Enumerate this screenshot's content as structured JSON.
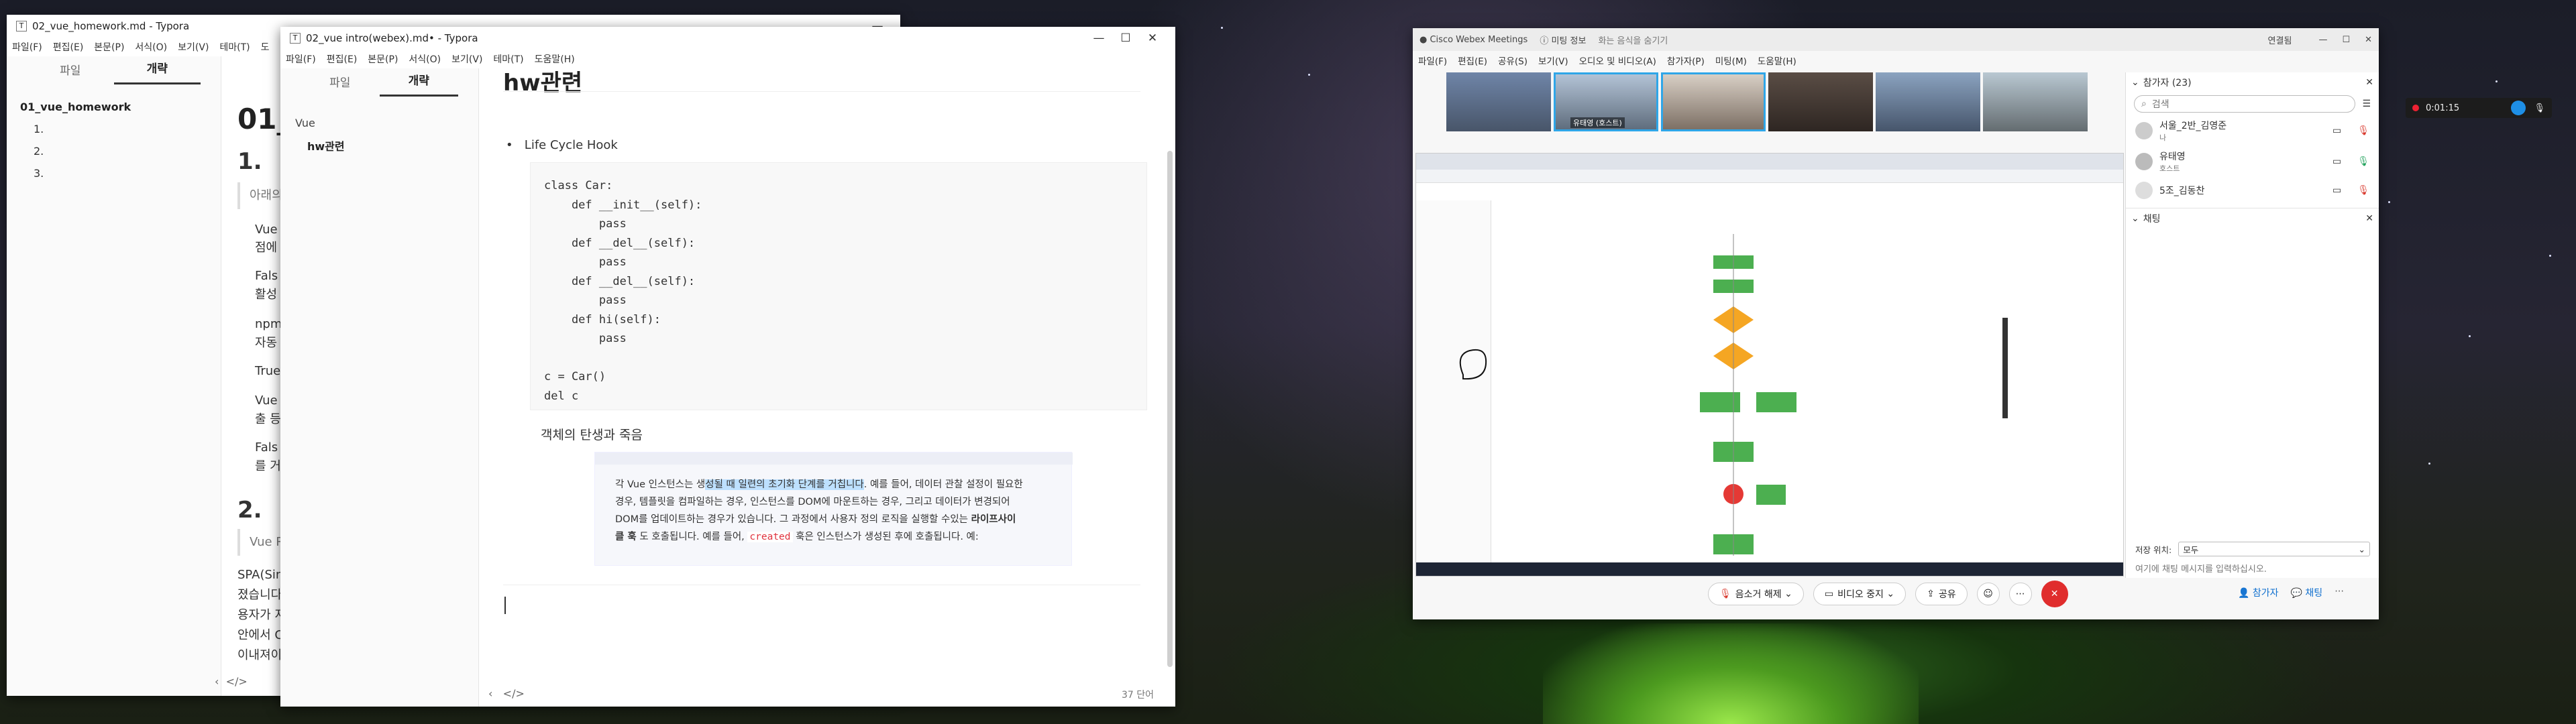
{
  "win1": {
    "title": "02_vue_homework.md - Typora",
    "menu": [
      "파일(F)",
      "편집(E)",
      "본문(P)",
      "서식(O)",
      "보기(V)",
      "테마(T)",
      "도"
    ],
    "tabs": [
      "파일",
      "개략"
    ],
    "outline": {
      "root": "01_vue_homework",
      "items": [
        "1.",
        "2.",
        "3."
      ]
    },
    "doc": {
      "h1": "01_",
      "h2a": "1.",
      "quote": "아래의",
      "b1": "Vue",
      "b1b": "점에",
      "f1": "Fals",
      "f1b": "활성",
      "b2": "npm",
      "b2b": "자동",
      "t2": "True",
      "b3": "Vue",
      "b3b": "출 등",
      "f3": "Fals",
      "f3b": "를 거",
      "h2b": "2.",
      "quote2": "Vue R",
      "p1": "SPA(Sing",
      "p2": "졌습니다",
      "p3": "용자가 지",
      "p4": "안에서 C",
      "p5": "이내져이"
    }
  },
  "win2": {
    "title": "02_vue intro(webex).md• - Typora",
    "menu": [
      "파일(F)",
      "편집(E)",
      "본문(P)",
      "서식(O)",
      "보기(V)",
      "테마(T)",
      "도움말(H)"
    ],
    "tabs": [
      "파일",
      "개략"
    ],
    "outline": {
      "root": "Vue",
      "child": "hw관련"
    },
    "doc": {
      "heading": "hw관련",
      "bullet": "Life Cycle Hook",
      "code": [
        "class Car:",
        "    def __init__(self):",
        "        pass",
        "    def __del__(self):",
        "        pass",
        "    def __del__(self):",
        "        pass",
        "    def hi(self):",
        "        pass",
        "",
        "c = Car()",
        "del c"
      ],
      "caption": "객체의 탄생과 죽음",
      "excerpt": {
        "pre": "각 Vue 인스턴스는 생",
        "hl": "성될 때 일련의 초기화 단계를 거칩니다",
        "rest1": ". 예를 들어, 데이터 관찰 설정이 필요한",
        "line2": "경우, 템플릿을 컴파일하는 경우, 인스턴스를 DOM에 마운트하는 경우, 그리고 데이터가 변경되어",
        "line3a": "DOM를 업데이트하는 경우가 있습니다. 그 과정에서 사용자 정의 로직을 실행할 수있는 ",
        "bold": "라이프사이",
        "line4a": "클 훅",
        "line4b": "도 호출됩니다. 예를 들어, ",
        "code": "created",
        "line4c": " 훅은 인스턴스가 생성된 후에 호출됩니다. 예:"
      }
    },
    "footer": {
      "words": "37 단어"
    }
  },
  "webex": {
    "tabs": [
      "Cisco Webex Meetings",
      "미팅 정보",
      "화는 음식을 숨기기"
    ],
    "badge": "연결됨",
    "menu": [
      "파일(F)",
      "편집(E)",
      "공유(S)",
      "보기(V)",
      "오디오 및 비디오(A)",
      "참가자(P)",
      "미팅(M)",
      "도움말(H)"
    ],
    "participants_label": "참가자 (23)",
    "search_placeholder": "검색",
    "people": [
      {
        "name": "서울_2반_김영준",
        "role": "나"
      },
      {
        "name": "유태영",
        "role": "호스트"
      },
      {
        "name": "5조_김동찬",
        "role": ""
      }
    ],
    "chat_label": "채팅",
    "chat_to_label": "저장 위치:",
    "chat_to_value": "모두",
    "chat_placeholder": "여기에 채팅 메시지를 입력하십시오.",
    "thumb_label": "유태영 (호스트)",
    "controls": {
      "mute": "음소거 해제",
      "video": "비디오 중지",
      "share": "공유",
      "participants": "참가자",
      "chat": "채팅"
    }
  },
  "recorder": {
    "time": "0:01:15"
  }
}
